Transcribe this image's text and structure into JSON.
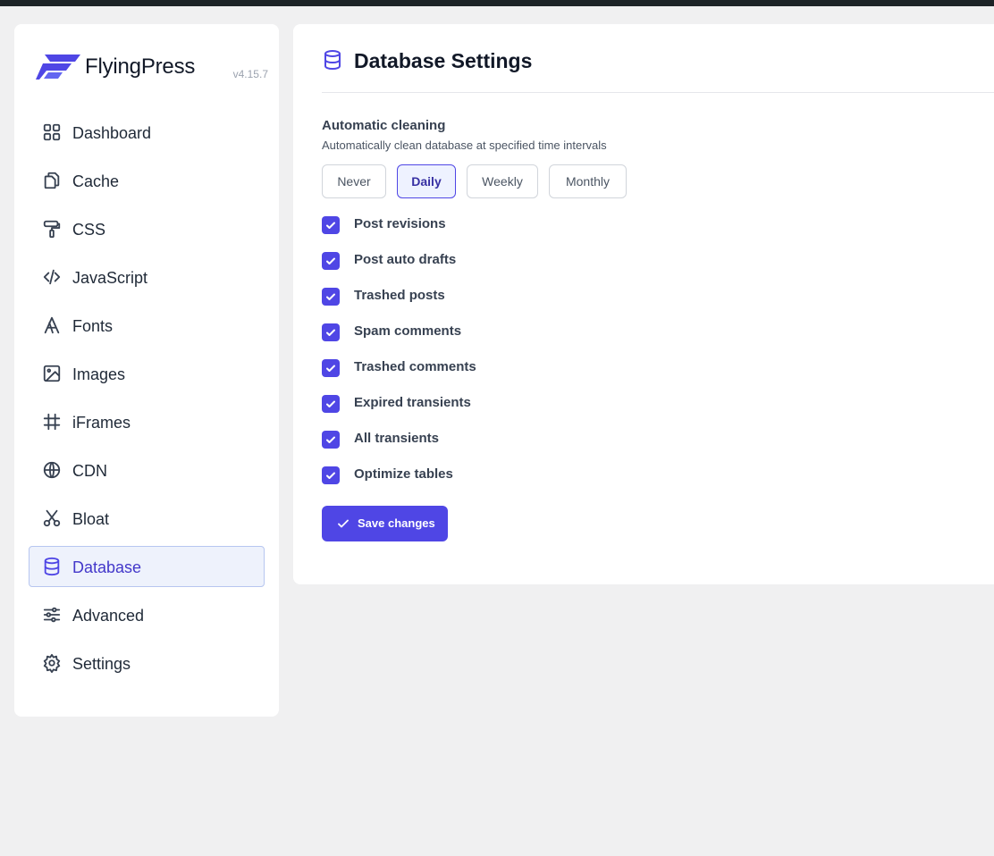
{
  "brand": {
    "name": "FlyingPress",
    "version": "v4.15.7",
    "logo_icon": "flyingpress-logo"
  },
  "sidebar": {
    "items": [
      {
        "label": "Dashboard",
        "icon": "dashboard-grid-icon",
        "active": false
      },
      {
        "label": "Cache",
        "icon": "copy-icon",
        "active": false
      },
      {
        "label": "CSS",
        "icon": "paint-roller-icon",
        "active": false
      },
      {
        "label": "JavaScript",
        "icon": "code-icon",
        "active": false
      },
      {
        "label": "Fonts",
        "icon": "font-icon",
        "active": false
      },
      {
        "label": "Images",
        "icon": "image-icon",
        "active": false
      },
      {
        "label": "iFrames",
        "icon": "frame-icon",
        "active": false
      },
      {
        "label": "CDN",
        "icon": "globe-icon",
        "active": false
      },
      {
        "label": "Bloat",
        "icon": "scissors-icon",
        "active": false
      },
      {
        "label": "Database",
        "icon": "database-icon",
        "active": true
      },
      {
        "label": "Advanced",
        "icon": "sliders-icon",
        "active": false
      },
      {
        "label": "Settings",
        "icon": "gear-icon",
        "active": false
      }
    ]
  },
  "main": {
    "title": "Database Settings",
    "title_icon": "database-icon",
    "section": {
      "title": "Automatic cleaning",
      "description": "Automatically clean database at specified time intervals"
    },
    "intervals": {
      "options": [
        "Never",
        "Daily",
        "Weekly",
        "Monthly"
      ],
      "selected": "Daily"
    },
    "options": [
      {
        "label": "Post revisions",
        "checked": true
      },
      {
        "label": "Post auto drafts",
        "checked": true
      },
      {
        "label": "Trashed posts",
        "checked": true
      },
      {
        "label": "Spam comments",
        "checked": true
      },
      {
        "label": "Trashed comments",
        "checked": true
      },
      {
        "label": "Expired transients",
        "checked": true
      },
      {
        "label": "All transients",
        "checked": true
      },
      {
        "label": "Optimize tables",
        "checked": true
      }
    ],
    "save_label": "Save changes"
  },
  "colors": {
    "accent": "#4f46e5",
    "active_bg": "#eef2fc",
    "page_bg": "#f0f0f1"
  }
}
